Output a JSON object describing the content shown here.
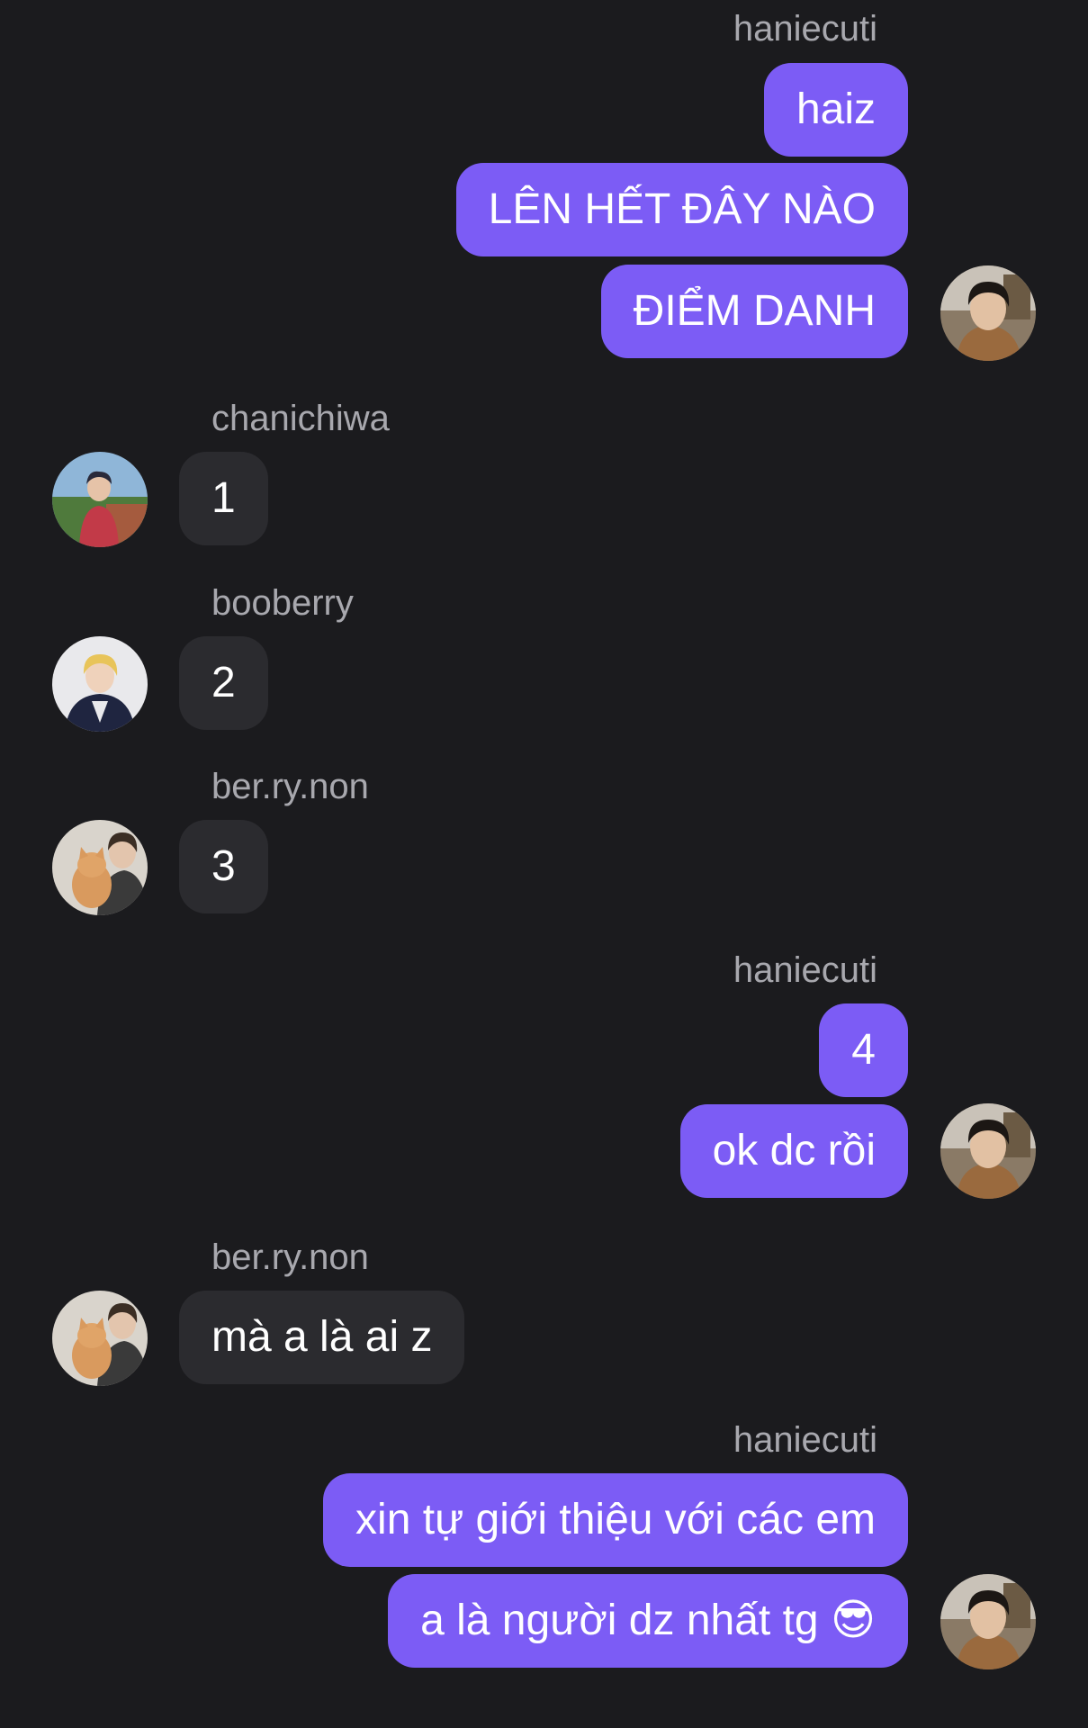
{
  "colors": {
    "background": "#1b1b1e",
    "outgoing_bubble": "#7c5cf5",
    "incoming_bubble": "#2b2b2f",
    "sender_name": "#a8a8ae"
  },
  "messages": {
    "group1": {
      "sender": "haniecuti",
      "texts": [
        "haiz",
        "LÊN HẾT ĐÂY NÀO",
        "ĐIỂM DANH"
      ],
      "avatar_icon": "user-avatar-icon"
    },
    "group2": {
      "sender": "chanichiwa",
      "texts": [
        "1"
      ],
      "avatar_icon": "user-avatar-icon"
    },
    "group3": {
      "sender": "booberry",
      "texts": [
        "2"
      ],
      "avatar_icon": "user-avatar-icon"
    },
    "group4": {
      "sender": "ber.ry.non",
      "texts": [
        "3"
      ],
      "avatar_icon": "user-avatar-icon"
    },
    "group5": {
      "sender": "haniecuti",
      "texts": [
        "4",
        "ok dc rồi"
      ],
      "avatar_icon": "user-avatar-icon"
    },
    "group6": {
      "sender": "ber.ry.non",
      "texts": [
        "mà a là ai z"
      ],
      "avatar_icon": "user-avatar-icon"
    },
    "group7": {
      "sender": "haniecuti",
      "texts": [
        "xin tự giới thiệu với các em",
        "a là người dz nhất tg 😎"
      ],
      "avatar_icon": "user-avatar-icon"
    }
  }
}
